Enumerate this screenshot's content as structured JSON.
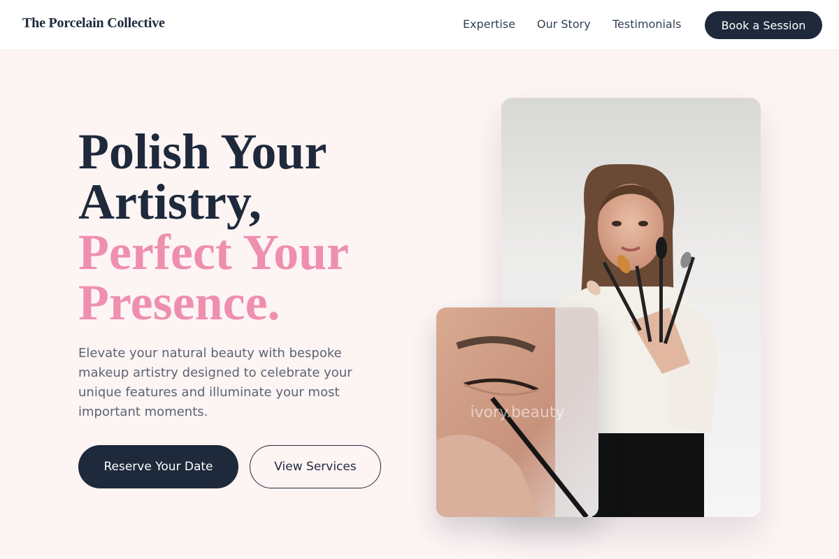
{
  "nav": {
    "brand": "The Porcelain Collective",
    "links": [
      "Expertise",
      "Our Story",
      "Testimonials"
    ],
    "cta": "Book a Session"
  },
  "hero": {
    "headline_dark": [
      "Polish Your",
      "Artistry,"
    ],
    "headline_accent": [
      "Perfect Your",
      "Presence."
    ],
    "lede": "Elevate your natural beauty with bespoke makeup artistry designed to celebrate your unique features and illuminate your most important moments.",
    "primary_button": "Reserve Your Date",
    "secondary_button": "View Services"
  },
  "images": {
    "inset_watermark": "ivory.beauty"
  },
  "colors": {
    "navy": "#1e293b",
    "accent_pink": "#ee8fb0",
    "background": "#fdf4f4"
  }
}
